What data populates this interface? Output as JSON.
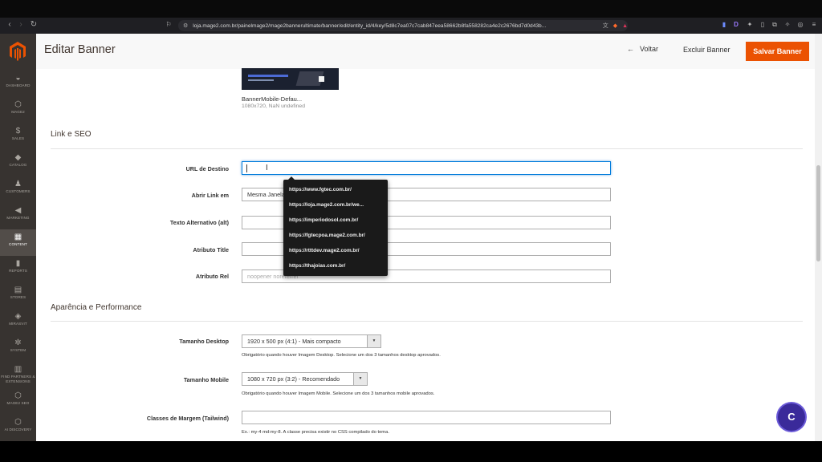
{
  "browser": {
    "url": "loja.mage2.com.br/painelmage2/mage2bannerultimate/banner/edit/entity_id/4/key/5d8c7ea07c7cab847eea58662b8fa558282ca4e2c2676bd7d0d43b..."
  },
  "header": {
    "title": "Editar Banner",
    "back_label": "Voltar",
    "delete_label": "Excluir Banner",
    "save_label": "Salvar Banner"
  },
  "sidebar": {
    "items": [
      {
        "label": "DASHBOARD",
        "icon": "dashboard-icon",
        "glyph": "◒"
      },
      {
        "label": "MAGE2",
        "icon": "hexagon-icon",
        "glyph": "⬡"
      },
      {
        "label": "SALES",
        "icon": "dollar-icon",
        "glyph": "$"
      },
      {
        "label": "CATALOG",
        "icon": "cube-icon",
        "glyph": "◆"
      },
      {
        "label": "CUSTOMERS",
        "icon": "person-icon",
        "glyph": "♟"
      },
      {
        "label": "MARKETING",
        "icon": "megaphone-icon",
        "glyph": "◀"
      },
      {
        "label": "CONTENT",
        "icon": "content-icon",
        "glyph": "▦"
      },
      {
        "label": "REPORTS",
        "icon": "bar-chart-icon",
        "glyph": "▮"
      },
      {
        "label": "STORES",
        "icon": "store-icon",
        "glyph": "▤"
      },
      {
        "label": "MIRASVIT",
        "icon": "mirasvit-icon",
        "glyph": "◈"
      },
      {
        "label": "SYSTEM",
        "icon": "gear-icon",
        "glyph": "✲"
      },
      {
        "label": "FIND PARTNERS & EXTENSIONS",
        "icon": "blocks-icon",
        "glyph": "▥"
      },
      {
        "label": "MAGE2 SEO",
        "icon": "hexagon-icon",
        "glyph": "⬡"
      },
      {
        "label": "AI DISCOVERY",
        "icon": "hexagon-icon",
        "glyph": "⬡"
      }
    ]
  },
  "image_preview": {
    "file_name": "BannerMobile-Defau...",
    "meta": "1080x720, NaN undefined"
  },
  "link_seo": {
    "title": "Link e SEO",
    "url_label": "URL de Destino",
    "url_value": "",
    "open_label": "Abrir Link em",
    "open_value": "Mesma Janela",
    "alt_label": "Texto Alternativo (alt)",
    "alt_value": "",
    "title_attr_label": "Atributo Title",
    "title_attr_value": "",
    "rel_label": "Atributo Rel",
    "rel_placeholder": "noopener noreferrer"
  },
  "autocomplete": [
    "https://www.fgtec.com.br/",
    "https://loja.mage2.com.br/we...",
    "https://imperiodosol.com.br/",
    "https://fgtecpoa.mage2.com.br/",
    "https://rtttdev.mage2.com.br/",
    "https://thajoias.com.br/"
  ],
  "appearance": {
    "title": "Aparência e Performance",
    "desktop_label": "Tamanho Desktop",
    "desktop_value": "1920 x 500 px (4:1) - Mais compacto",
    "desktop_note": "Obrigatório quando houver Imagem Desktop. Selecione um dos 3 tamanhos desktop aprovados.",
    "mobile_label": "Tamanho Mobile",
    "mobile_value": "1080 x 720 px (3:2) - Recomendado",
    "mobile_note": "Obrigatório quando houver Imagem Mobile. Selecione um dos 3 tamanhos mobile aprovados.",
    "margin_label": "Classes de Margem (Tailwind)",
    "margin_value": "",
    "margin_note": "Ex.: my-4 md:my-8. A classe precisa existir no CSS compilado do tema."
  },
  "chat": {
    "label": "C"
  },
  "colors": {
    "accent": "#eb5202",
    "sidebar": "#373330",
    "focus": "#007bdb"
  }
}
